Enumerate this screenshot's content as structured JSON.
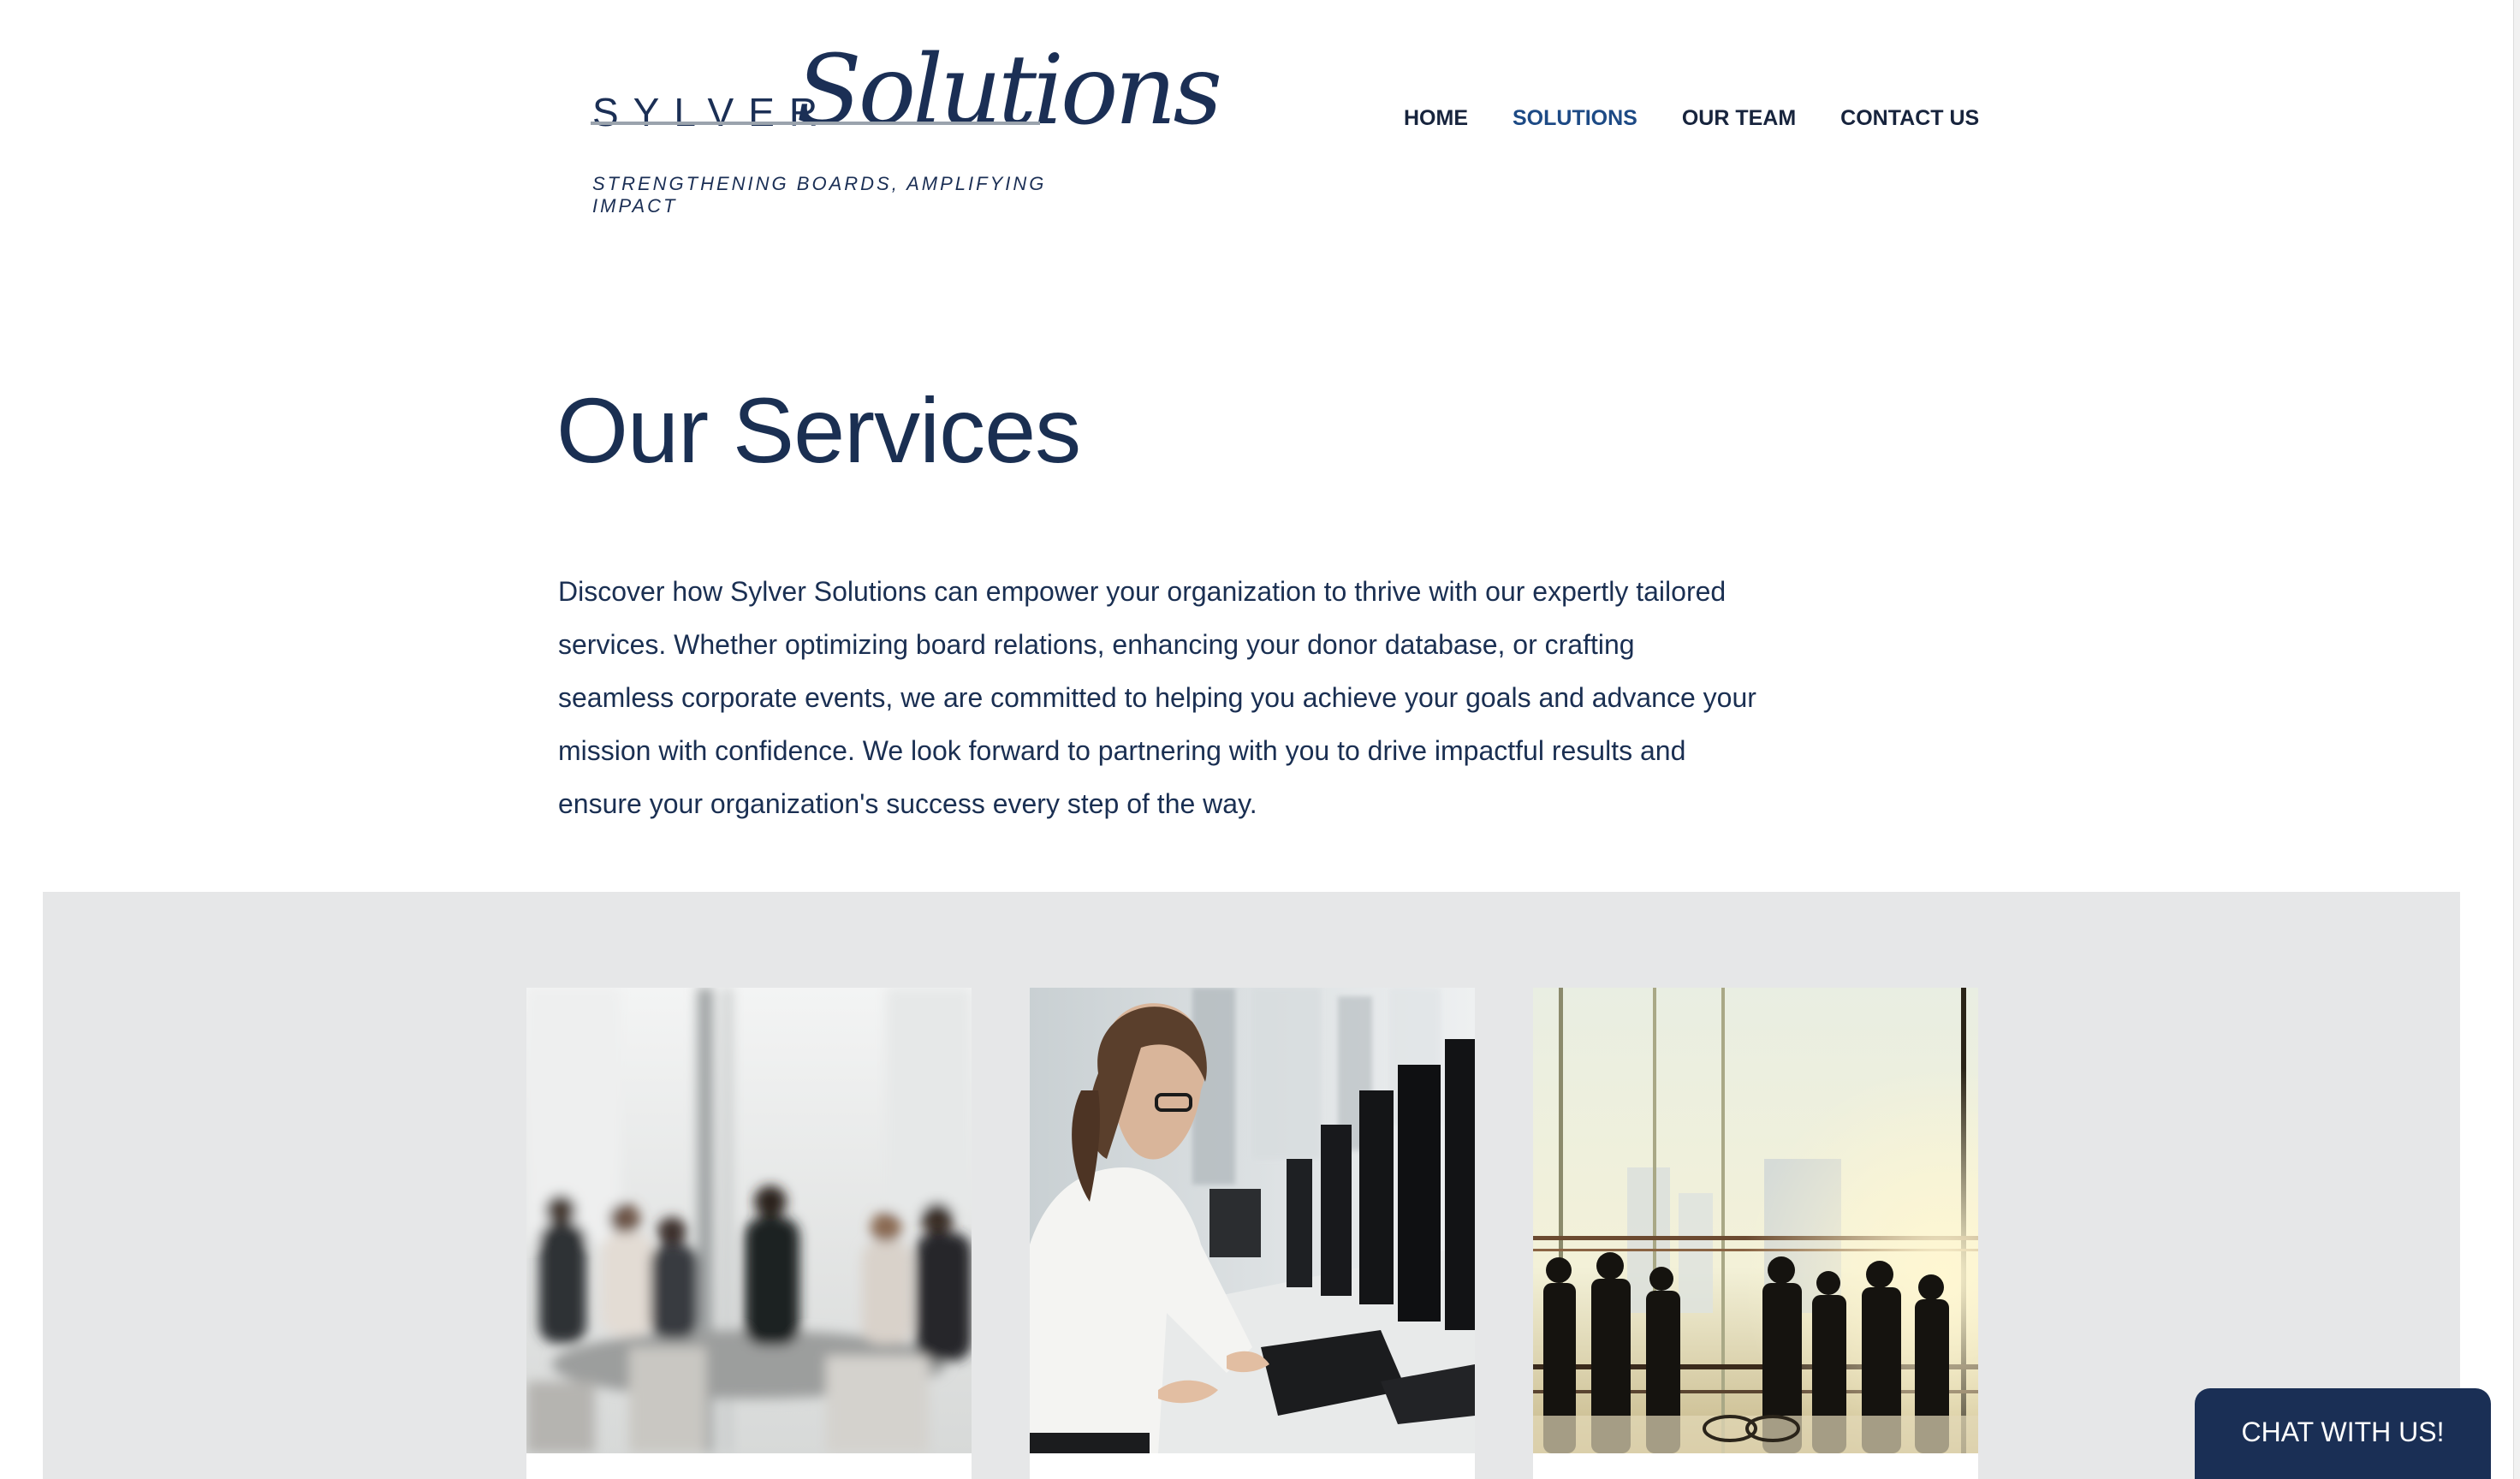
{
  "brand": {
    "name": "SYLVER",
    "script": "Solutions",
    "tagline": "STRENGTHENING BOARDS, AMPLIFYING IMPACT"
  },
  "nav": {
    "items": [
      {
        "label": "HOME",
        "active": false
      },
      {
        "label": "SOLUTIONS",
        "active": true
      },
      {
        "label": "OUR TEAM",
        "active": false
      },
      {
        "label": "CONTACT US",
        "active": false
      }
    ]
  },
  "hero": {
    "title": "Our Services",
    "intro": "Discover how Sylver Solutions can empower your organization to thrive with our expertly tailored services. Whether optimizing board relations, enhancing your donor database, or crafting seamless corporate events, we are committed to helping you achieve your goals and advance your mission with confidence. We look forward to partnering with you to drive impactful results and ensure your organization's success every step of the way."
  },
  "cards": [
    {
      "image": "board-meeting-photo"
    },
    {
      "image": "woman-at-computer-photo"
    },
    {
      "image": "corporate-event-silhouettes-photo"
    }
  ],
  "chat": {
    "label": "CHAT WITH US!"
  },
  "colors": {
    "brand_navy": "#1a2f52",
    "band_gray": "#e6e7e8",
    "nav_active": "#1d4a85"
  }
}
